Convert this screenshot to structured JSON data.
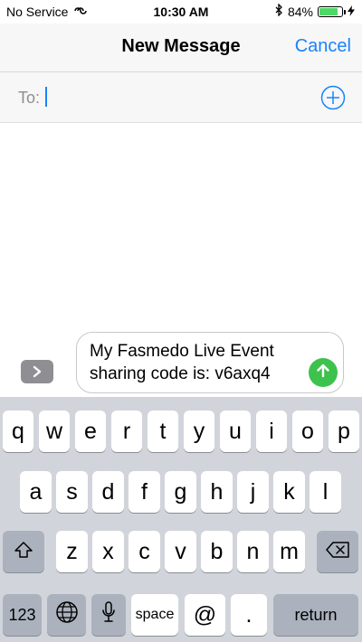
{
  "status_bar": {
    "carrier": "No Service",
    "time": "10:30 AM",
    "battery": "84%",
    "battery_level": 0.84,
    "icons": [
      "wifi-calling-icon",
      "bluetooth-icon",
      "battery-icon",
      "charging-bolt-icon"
    ]
  },
  "nav": {
    "title": "New Message",
    "cancel": "Cancel"
  },
  "to_field": {
    "label": "To:",
    "value": "",
    "add_icon": "plus-circle-icon"
  },
  "compose": {
    "message": "My Fasmedo Live Event sharing code is: v6axq4",
    "expand_icon": "chevron-right-icon",
    "send_icon": "arrow-up-icon",
    "send_color": "#3dc24d"
  },
  "keyboard": {
    "row1": [
      "q",
      "w",
      "e",
      "r",
      "t",
      "y",
      "u",
      "i",
      "o",
      "p"
    ],
    "row2": [
      "a",
      "s",
      "d",
      "f",
      "g",
      "h",
      "j",
      "k",
      "l"
    ],
    "row3": [
      "z",
      "x",
      "c",
      "v",
      "b",
      "n",
      "m"
    ],
    "numbers_key": "123",
    "space_key": "space",
    "at_key": "@",
    "period_key": ".",
    "return_key": "return",
    "icons": [
      "shift-icon",
      "delete-icon",
      "globe-icon",
      "microphone-icon"
    ]
  },
  "colors": {
    "accent": "#1a82fb",
    "keyboard_bg": "#d1d5db",
    "battery_fill": "#4cd964"
  }
}
